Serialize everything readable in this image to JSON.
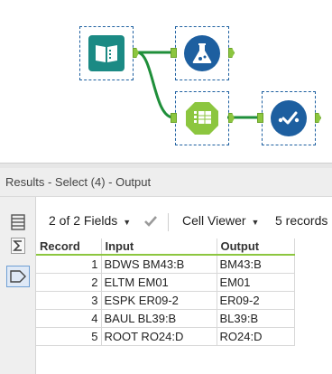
{
  "results": {
    "title": "Results - Select (4) - Output",
    "fields_label": "2 of 2 Fields",
    "viewer_label": "Cell Viewer",
    "records_label": "5 records"
  },
  "grid": {
    "columns": [
      "Record",
      "Input",
      "Output"
    ],
    "rows": [
      {
        "record": "1",
        "input": "BDWS BM43:B",
        "output": "BM43:B"
      },
      {
        "record": "2",
        "input": "ELTM EM01",
        "output": "EM01"
      },
      {
        "record": "3",
        "input": "ESPK ER09-2",
        "output": "ER09-2"
      },
      {
        "record": "4",
        "input": "BAUL BL39:B",
        "output": "BL39:B"
      },
      {
        "record": "5",
        "input": "ROOT RO24:D",
        "output": "RO24:D"
      }
    ]
  },
  "colors": {
    "input_tool": "#1b8a84",
    "browse_tool": "#1d5fa0",
    "select_tool": "#8cc63f",
    "connector": "#1f8f3a"
  }
}
